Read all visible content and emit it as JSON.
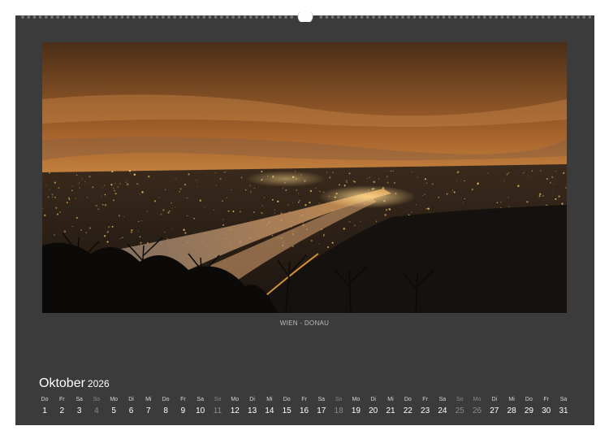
{
  "photo": {
    "caption": "WIEN - DONAU",
    "description_icon": "night-city-photo"
  },
  "month": {
    "name": "Oktober",
    "year": "2026"
  },
  "days": [
    {
      "dw": "Do",
      "dn": "1",
      "type": "weekday"
    },
    {
      "dw": "Fr",
      "dn": "2",
      "type": "weekday"
    },
    {
      "dw": "Sa",
      "dn": "3",
      "type": "weekday"
    },
    {
      "dw": "So",
      "dn": "4",
      "type": "sunday"
    },
    {
      "dw": "Mo",
      "dn": "5",
      "type": "weekday"
    },
    {
      "dw": "Di",
      "dn": "6",
      "type": "weekday"
    },
    {
      "dw": "Mi",
      "dn": "7",
      "type": "weekday"
    },
    {
      "dw": "Do",
      "dn": "8",
      "type": "weekday"
    },
    {
      "dw": "Fr",
      "dn": "9",
      "type": "weekday"
    },
    {
      "dw": "Sa",
      "dn": "10",
      "type": "weekday"
    },
    {
      "dw": "So",
      "dn": "11",
      "type": "sunday"
    },
    {
      "dw": "Mo",
      "dn": "12",
      "type": "weekday"
    },
    {
      "dw": "Di",
      "dn": "13",
      "type": "weekday"
    },
    {
      "dw": "Mi",
      "dn": "14",
      "type": "weekday"
    },
    {
      "dw": "Do",
      "dn": "15",
      "type": "weekday"
    },
    {
      "dw": "Fr",
      "dn": "16",
      "type": "weekday"
    },
    {
      "dw": "Sa",
      "dn": "17",
      "type": "weekday"
    },
    {
      "dw": "So",
      "dn": "18",
      "type": "sunday"
    },
    {
      "dw": "Mo",
      "dn": "19",
      "type": "weekday"
    },
    {
      "dw": "Di",
      "dn": "20",
      "type": "weekday"
    },
    {
      "dw": "Mi",
      "dn": "21",
      "type": "weekday"
    },
    {
      "dw": "Do",
      "dn": "22",
      "type": "weekday"
    },
    {
      "dw": "Fr",
      "dn": "23",
      "type": "weekday"
    },
    {
      "dw": "Sa",
      "dn": "24",
      "type": "weekday"
    },
    {
      "dw": "So",
      "dn": "25",
      "type": "sunday"
    },
    {
      "dw": "Mo",
      "dn": "26",
      "type": "holiday"
    },
    {
      "dw": "Di",
      "dn": "27",
      "type": "weekday"
    },
    {
      "dw": "Mi",
      "dn": "28",
      "type": "weekday"
    },
    {
      "dw": "Do",
      "dn": "29",
      "type": "weekday"
    },
    {
      "dw": "Fr",
      "dn": "30",
      "type": "weekday"
    },
    {
      "dw": "Sa",
      "dn": "31",
      "type": "weekday"
    }
  ],
  "colors": {
    "page": "#3b3b3b",
    "sky_top": "#5a3a20",
    "sky_glow": "#e0a45a",
    "city_lights": "#ffcf6a",
    "sunday": "#8a8a8a"
  }
}
